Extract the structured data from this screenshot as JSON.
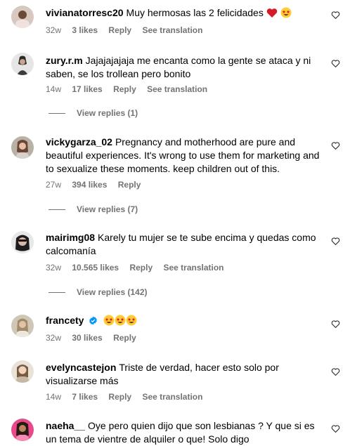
{
  "comments": [
    {
      "username": "vivianatorresc20",
      "text": "Muy hermosas las 2 felicidades",
      "time": "32w",
      "likes": "3 likes",
      "reply": "Reply",
      "translate": "See translation",
      "emoji": [
        "red-heart",
        "star-struck"
      ]
    },
    {
      "username": "zury.r.m",
      "text": "Jajajajajaja me encanta como la gente se ataca y ni saben, se los trollean pero bonito",
      "time": "14w",
      "likes": "17 likes",
      "reply": "Reply",
      "translate": "See translation",
      "view_replies": "View replies (1)"
    },
    {
      "username": "vickygarza_02",
      "text": "Pregnancy and motherhood are pure and beautiful experiences. It's wrong to use them for marketing and to sexualize these moments. keep children out of this.",
      "time": "27w",
      "likes": "394 likes",
      "reply": "Reply",
      "view_replies": "View replies (7)"
    },
    {
      "username": "mairimg08",
      "text": "Karely tu mujer se te sube encima y quedas como calcomanía",
      "time": "32w",
      "likes": "10.565 likes",
      "reply": "Reply",
      "translate": "See translation",
      "view_replies": "View replies (142)"
    },
    {
      "username": "francety",
      "text": "",
      "time": "32w",
      "likes": "30 likes",
      "reply": "Reply",
      "verified": true,
      "emoji": [
        "star-struck",
        "star-struck",
        "star-struck"
      ]
    },
    {
      "username": "evelyncastejon",
      "text": "Triste de verdad, hacer esto solo por visualizarse más",
      "time": "14w",
      "likes": "7 likes",
      "reply": "Reply",
      "translate": "See translation"
    },
    {
      "username": "naeha__",
      "text": "Oye pero quien dijo que son lesbianas ? Y que si es un tema de vientre de alquiler o que! Solo digo"
    }
  ],
  "colors": {
    "meta_text": "#737373",
    "heart_red": "#e0202e",
    "verified_blue": "#0095f6",
    "emoji_yellow": "#ffcc33"
  }
}
